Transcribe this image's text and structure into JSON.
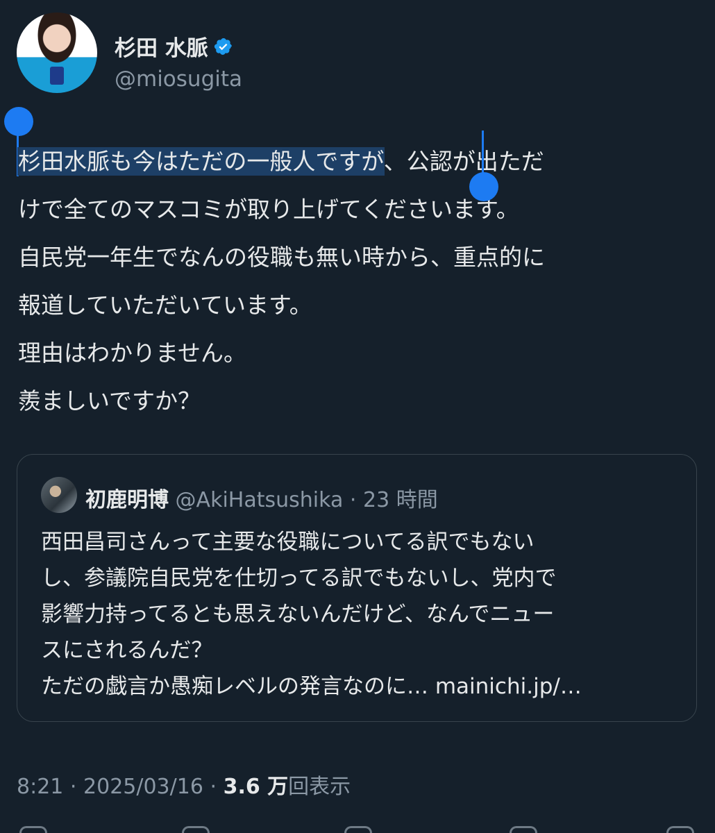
{
  "author": {
    "display_name": "杉田 水脈",
    "handle": "@miosugita",
    "verified": true
  },
  "tweet": {
    "lines": [
      {
        "highlighted": "杉田水脈も今はただの一般人ですが",
        "rest": "、公認が出ただ"
      },
      {
        "highlighted": "",
        "rest": "けで全てのマスコミが取り上げてくださいます。"
      },
      {
        "highlighted": "",
        "rest": "自民党一年生でなんの役職も無い時から、重点的に"
      },
      {
        "highlighted": "",
        "rest": "報道していただいています。"
      },
      {
        "highlighted": "",
        "rest": "理由はわかりません。"
      },
      {
        "highlighted": "",
        "rest": "羨ましいですか？"
      }
    ]
  },
  "quote": {
    "name": "初鹿明博",
    "handle": "@AkiHatsushika",
    "separator": "·",
    "time": "23 時間",
    "lines": [
      "西田昌司さんって主要な役職についてる訳でもない",
      "し、参議院自民党を仕切ってる訳でもないし、党内で",
      "影響力持ってるとも思えないんだけど、なんでニュー",
      "スにされるんだ？",
      "ただの戯言か愚痴レベルの発言なのに… mainichi.jp/…"
    ]
  },
  "meta": {
    "time": "8:21",
    "separator": "·",
    "date": "2025/03/16",
    "separator2": "·",
    "views_count": "3.6 万",
    "views_label": "回表示"
  },
  "colors": {
    "background": "#15202b",
    "accent": "#1d7bf2",
    "selection": "#1d3f66",
    "secondary_text": "#8b98a5"
  },
  "icons": [
    "verified-badge-icon",
    "reply-icon",
    "retweet-icon",
    "like-icon",
    "share-icon"
  ]
}
